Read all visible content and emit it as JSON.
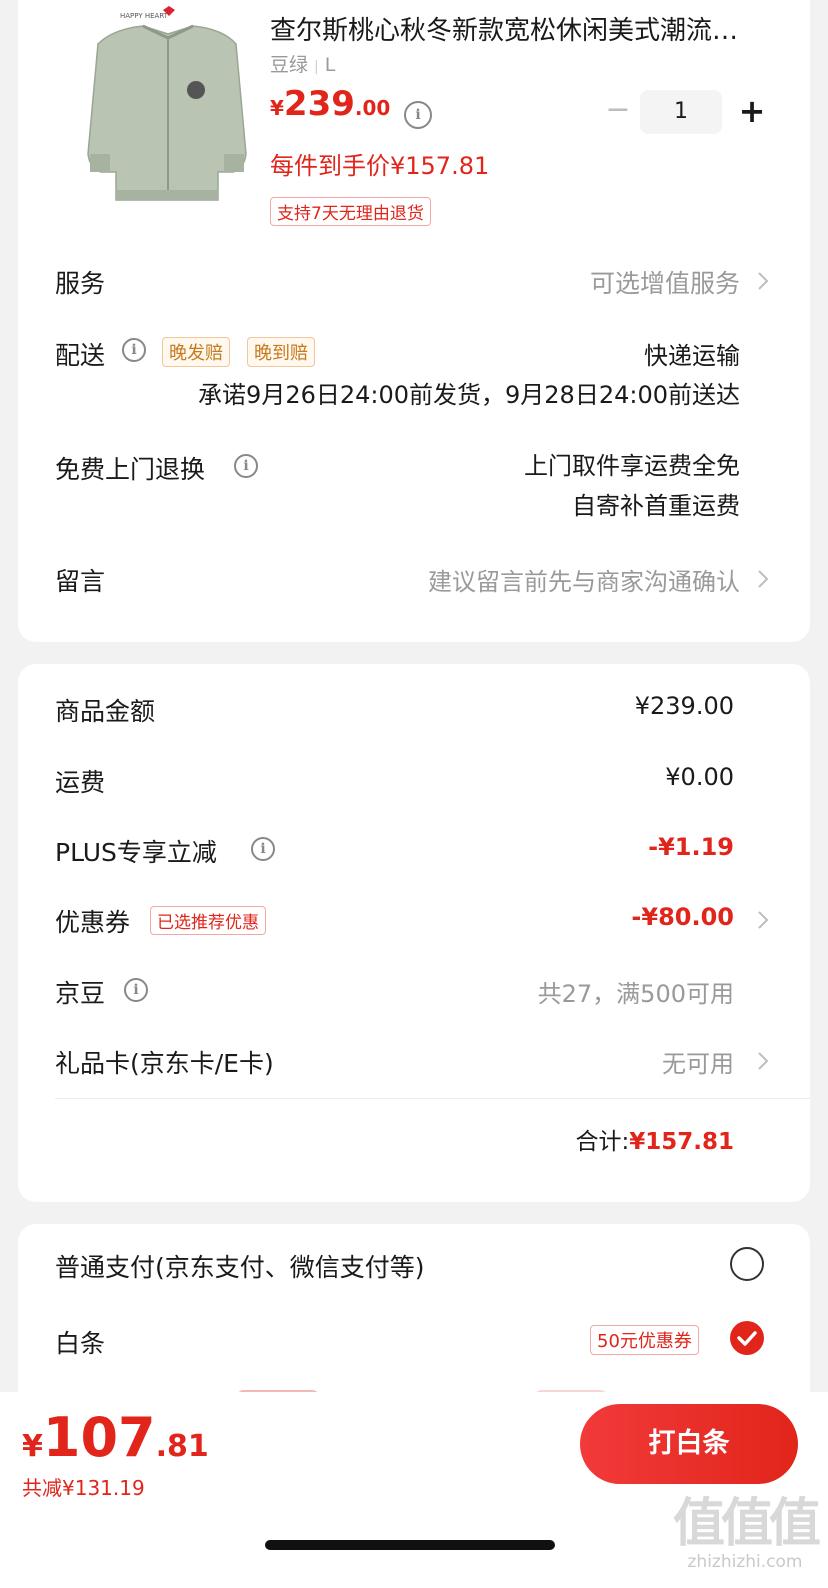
{
  "product": {
    "title": "查尔斯桃心秋冬新款宽松休闲美式潮流…",
    "spec_color": "豆绿",
    "spec_size": "L",
    "price_currency": "¥",
    "price_int": "239",
    "price_dec": ".00",
    "final_price": "每件到手价¥157.81",
    "return_badge": "支持7天无理由退货",
    "quantity": "1",
    "logo_text": "HAPPY HEART"
  },
  "rows": {
    "service_label": "服务",
    "service_value": "可选增值服务",
    "delivery_label": "配送",
    "delivery_tag1": "晚发赔",
    "delivery_tag2": "晚到赔",
    "delivery_method": "快递运输",
    "delivery_promise": "承诺9月26日24:00前发货，9月28日24:00前送达",
    "return_label": "免费上门退换",
    "return_line1": "上门取件享运费全免",
    "return_line2": "自寄补首重运费",
    "note_label": "留言",
    "note_placeholder": "建议留言前先与商家沟通确认"
  },
  "summary": {
    "goods_label": "商品金额",
    "goods_value": "¥239.00",
    "shipping_label": "运费",
    "shipping_value": "¥0.00",
    "plus_label": "PLUS专享立减",
    "plus_value": "-¥1.19",
    "coupon_label": "优惠券",
    "coupon_tag": "已选推荐优惠",
    "coupon_value": "-¥80.00",
    "jingdou_label": "京豆",
    "jingdou_value": "共27，满500可用",
    "giftcard_label": "礼品卡(京东卡/E卡)",
    "giftcard_value": "无可用",
    "total_label": "合计:",
    "total_value": "¥157.81"
  },
  "payment": {
    "normal_label": "普通支付(京东支付、微信支付等)",
    "normal_selected": false,
    "baitiao_label": "白条",
    "baitiao_coupon": "50元优惠券",
    "baitiao_selected": true
  },
  "bottom": {
    "currency": "¥",
    "total_int": "107",
    "total_dec": ".81",
    "discount": "共减¥131.19",
    "pay_button": "打白条"
  },
  "watermark": {
    "big": "值值值",
    "small": "zhizhizhi.com"
  },
  "colors": {
    "accent": "#e1251b",
    "tag_orange": "#c87a1b",
    "muted": "#9a9a9a",
    "jacket": "#b9c4b3"
  },
  "icons": [
    "info-icon",
    "chevron-right-icon",
    "radio-checked-icon",
    "radio-unchecked-icon",
    "minus-icon",
    "plus-icon"
  ]
}
